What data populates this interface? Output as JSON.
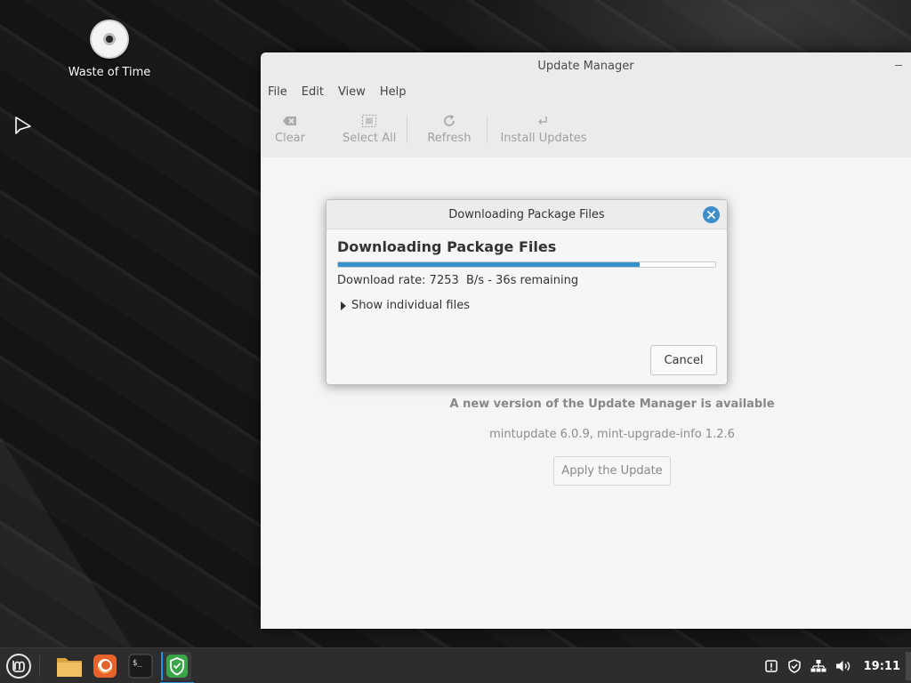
{
  "desktop": {
    "icons": [
      {
        "label": "Waste of Time",
        "icon": "disc-icon"
      }
    ]
  },
  "window": {
    "title": "Update Manager",
    "menu": [
      "File",
      "Edit",
      "View",
      "Help"
    ],
    "toolbar": {
      "clear_label": "Clear",
      "select_all_label": "Select All",
      "refresh_label": "Refresh",
      "install_label": "Install Updates"
    },
    "notice": "A new version of the Update Manager is available",
    "versions": "mintupdate 6.0.9, mint-upgrade-info 1.2.6",
    "apply_label": "Apply the Update"
  },
  "dialog": {
    "title": "Downloading Package Files",
    "heading": "Downloading Package Files",
    "progress": 0.8,
    "rate_text": "Download rate: 7253  B/s - 36s remaining",
    "expander_label": "Show individual files",
    "cancel_label": "Cancel"
  },
  "taskbar": {
    "launchers": [
      "mint-menu-icon",
      "files-icon",
      "firefox-icon",
      "terminal-icon",
      "update-manager-shield-icon"
    ],
    "tray": [
      "notifications-icon",
      "shield-tray-icon",
      "network-icon",
      "volume-icon"
    ],
    "clock": "19:11"
  },
  "colors": {
    "accent": "#3591cb",
    "shield_green": "#3aa549",
    "taskbar_bg": "#2d2d2d"
  }
}
